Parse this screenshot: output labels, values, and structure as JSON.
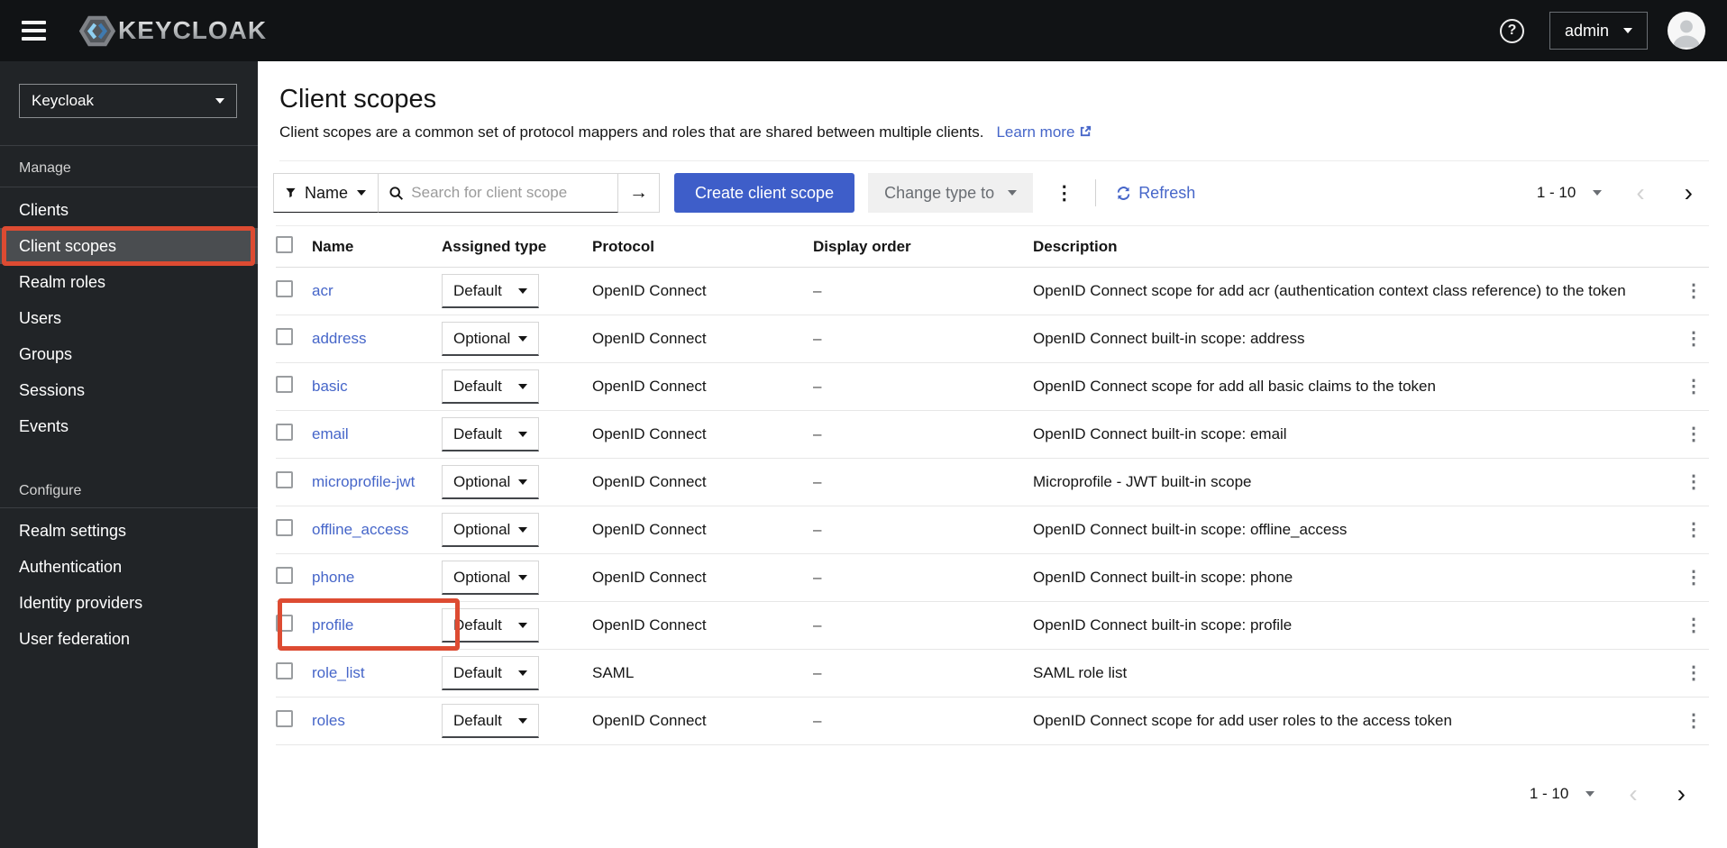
{
  "masthead": {
    "brand": "KEYCLOAK",
    "help_symbol": "?",
    "user_label": "admin"
  },
  "sidebar": {
    "realm": "Keycloak",
    "groups": [
      {
        "label": "Manage",
        "items": [
          {
            "label": "Clients"
          },
          {
            "label": "Client scopes",
            "selected": true
          },
          {
            "label": "Realm roles"
          },
          {
            "label": "Users"
          },
          {
            "label": "Groups"
          },
          {
            "label": "Sessions"
          },
          {
            "label": "Events"
          }
        ]
      },
      {
        "label": "Configure",
        "items": [
          {
            "label": "Realm settings"
          },
          {
            "label": "Authentication"
          },
          {
            "label": "Identity providers"
          },
          {
            "label": "User federation"
          }
        ]
      }
    ]
  },
  "page": {
    "title": "Client scopes",
    "description": "Client scopes are a common set of protocol mappers and roles that are shared between multiple clients.",
    "learn_more": "Learn more"
  },
  "toolbar": {
    "filter_label": "Name",
    "search_placeholder": "Search for client scope",
    "create_button": "Create client scope",
    "change_type_button": "Change type to",
    "refresh_label": "Refresh",
    "arrow_symbol": "→",
    "kebab_symbol": "⋮",
    "prev_symbol": "‹",
    "next_symbol": "›"
  },
  "pagination": {
    "range": "1 - 10"
  },
  "table": {
    "columns": [
      "Name",
      "Assigned type",
      "Protocol",
      "Display order",
      "Description"
    ],
    "rows": [
      {
        "name": "acr",
        "type": "Default",
        "protocol": "OpenID Connect",
        "display_order": "–",
        "description": "OpenID Connect scope for add acr (authentication context class reference) to the token"
      },
      {
        "name": "address",
        "type": "Optional",
        "protocol": "OpenID Connect",
        "display_order": "–",
        "description": "OpenID Connect built-in scope: address"
      },
      {
        "name": "basic",
        "type": "Default",
        "protocol": "OpenID Connect",
        "display_order": "–",
        "description": "OpenID Connect scope for add all basic claims to the token"
      },
      {
        "name": "email",
        "type": "Default",
        "protocol": "OpenID Connect",
        "display_order": "–",
        "description": "OpenID Connect built-in scope: email"
      },
      {
        "name": "microprofile-jwt",
        "type": "Optional",
        "protocol": "OpenID Connect",
        "display_order": "–",
        "description": "Microprofile - JWT built-in scope"
      },
      {
        "name": "offline_access",
        "type": "Optional",
        "protocol": "OpenID Connect",
        "display_order": "–",
        "description": "OpenID Connect built-in scope: offline_access"
      },
      {
        "name": "phone",
        "type": "Optional",
        "protocol": "OpenID Connect",
        "display_order": "–",
        "description": "OpenID Connect built-in scope: phone"
      },
      {
        "name": "profile",
        "type": "Default",
        "protocol": "OpenID Connect",
        "display_order": "–",
        "description": "OpenID Connect built-in scope: profile",
        "highlighted": true
      },
      {
        "name": "role_list",
        "type": "Default",
        "protocol": "SAML",
        "display_order": "–",
        "description": "SAML role list"
      },
      {
        "name": "roles",
        "type": "Default",
        "protocol": "OpenID Connect",
        "display_order": "–",
        "description": "OpenID Connect scope for add user roles to the access token"
      }
    ]
  },
  "colors": {
    "primary_button": "#3e5ec9",
    "link": "#4666c9",
    "annotation": "#dd4b32",
    "masthead_bg": "#111315",
    "sidebar_bg": "#212427",
    "selected_nav_bg": "#4a4d50"
  }
}
